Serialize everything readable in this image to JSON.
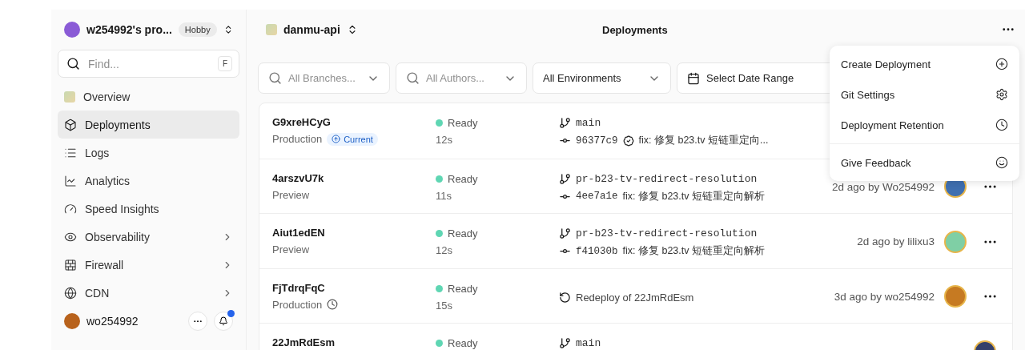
{
  "sidebar": {
    "team": {
      "name": "w254992's pro...",
      "plan": "Hobby"
    },
    "search": {
      "placeholder": "Find...",
      "shortcut": "F"
    },
    "items": [
      {
        "label": "Overview",
        "selected": false,
        "chevron": false
      },
      {
        "label": "Deployments",
        "selected": true,
        "chevron": false
      },
      {
        "label": "Logs",
        "selected": false,
        "chevron": false
      },
      {
        "label": "Analytics",
        "selected": false,
        "chevron": false
      },
      {
        "label": "Speed Insights",
        "selected": false,
        "chevron": false
      },
      {
        "label": "Observability",
        "selected": false,
        "chevron": true
      },
      {
        "label": "Firewall",
        "selected": false,
        "chevron": true
      },
      {
        "label": "CDN",
        "selected": false,
        "chevron": true
      }
    ],
    "user": {
      "name": "wo254992",
      "notification": true
    }
  },
  "header": {
    "project": "danmu-api",
    "title": "Deployments"
  },
  "filters": [
    {
      "kind": "search",
      "label": "All Branches..."
    },
    {
      "kind": "search",
      "label": "All Authors..."
    },
    {
      "kind": "select",
      "label": "All Environments"
    },
    {
      "kind": "date",
      "label": "Select Date Range"
    }
  ],
  "deployments": [
    {
      "kind": "git",
      "id": "G9xreHCyG",
      "environment": "Production",
      "badge": "Current",
      "retention_timer": false,
      "status": "Ready",
      "duration": "12s",
      "branch": "main",
      "commit": "96377c9",
      "verified": true,
      "message": "fix: 修复 b23.tv 短链重定向..."
    },
    {
      "kind": "git",
      "id": "4arszvU7k",
      "environment": "Preview",
      "retention_timer": false,
      "status": "Ready",
      "duration": "11s",
      "branch": "pr-b23-tv-redirect-resolution",
      "commit": "4ee7a1e",
      "verified": false,
      "message": "fix: 修复 b23.tv 短链重定向解析",
      "meta": "2d ago by Wo254992"
    },
    {
      "kind": "git",
      "id": "Aiut1edEN",
      "environment": "Preview",
      "retention_timer": false,
      "status": "Ready",
      "duration": "12s",
      "branch": "pr-b23-tv-redirect-resolution",
      "commit": "f41030b",
      "verified": false,
      "message": "fix: 修复 b23.tv 短链重定向解析",
      "meta": "2d ago by lilixu3"
    },
    {
      "kind": "redeploy",
      "id": "FjTdrqFqC",
      "environment": "Production",
      "retention_timer": true,
      "status": "Ready",
      "duration": "15s",
      "redeploy": "Redeploy of 22JmRdEsm",
      "meta": "3d ago by wo254992"
    },
    {
      "kind": "git",
      "id": "22JmRdEsm",
      "status": "Ready",
      "branch": "main"
    }
  ],
  "menu": {
    "groups": [
      [
        {
          "label": "Create Deployment"
        },
        {
          "label": "Git Settings"
        },
        {
          "label": "Deployment Retention"
        }
      ],
      [
        {
          "label": "Give Feedback"
        }
      ]
    ]
  }
}
